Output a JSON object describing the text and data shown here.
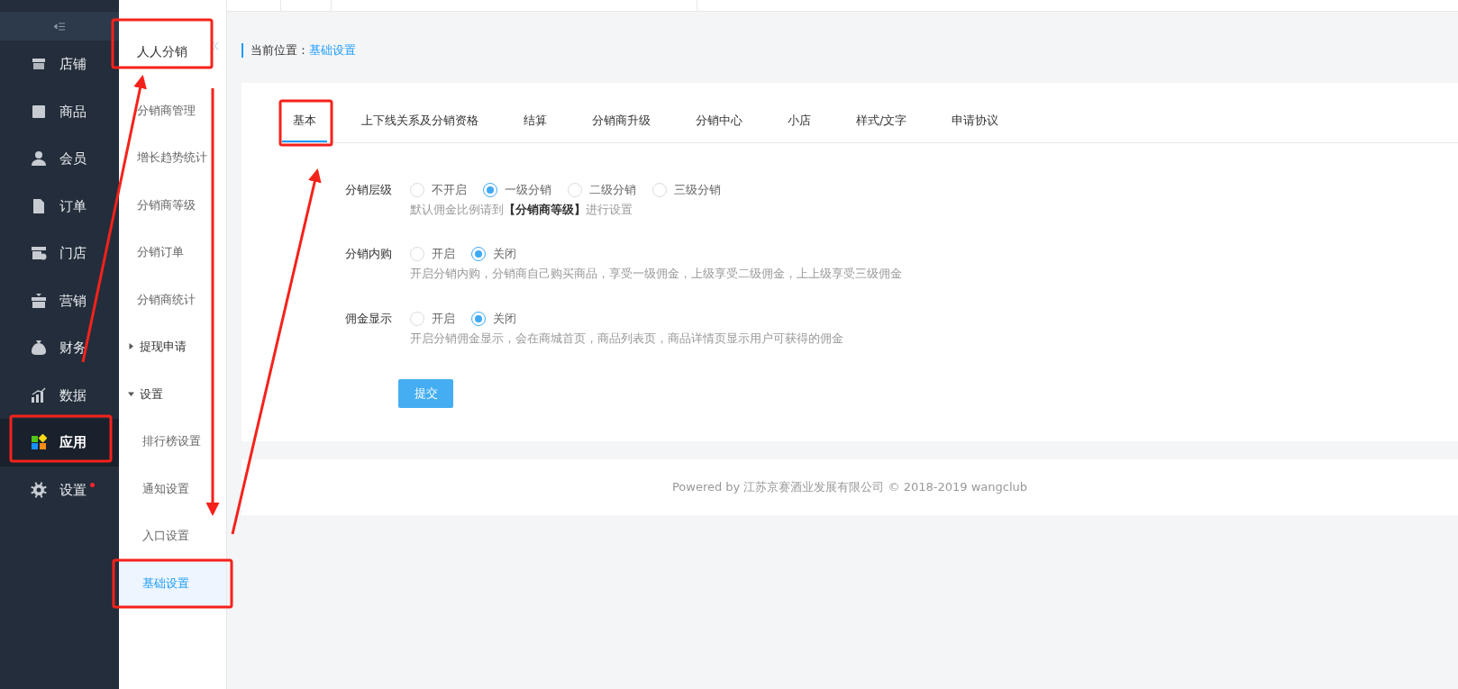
{
  "sidebar": {
    "items": [
      {
        "label": "店铺",
        "selected": false,
        "dot": false
      },
      {
        "label": "商品",
        "selected": false,
        "dot": false
      },
      {
        "label": "会员",
        "selected": false,
        "dot": false
      },
      {
        "label": "订单",
        "selected": false,
        "dot": false
      },
      {
        "label": "门店",
        "selected": false,
        "dot": false
      },
      {
        "label": "营销",
        "selected": false,
        "dot": false
      },
      {
        "label": "财务",
        "selected": false,
        "dot": false
      },
      {
        "label": "数据",
        "selected": false,
        "dot": false
      },
      {
        "label": "应用",
        "selected": true,
        "dot": false
      },
      {
        "label": "设置",
        "selected": false,
        "dot": true
      }
    ]
  },
  "subnav": {
    "title": "人人分销",
    "items": [
      {
        "label": "分销商管理",
        "selected": false
      },
      {
        "label": "增长趋势统计",
        "selected": false
      },
      {
        "label": "分销商等级",
        "selected": false
      },
      {
        "label": "分销订单",
        "selected": false
      },
      {
        "label": "分销商统计",
        "selected": false
      },
      {
        "label": "提现申请",
        "expanded": false
      },
      {
        "label": "设置",
        "expanded": true,
        "children": [
          {
            "label": "排行榜设置",
            "selected": false
          },
          {
            "label": "通知设置",
            "selected": false
          },
          {
            "label": "入口设置",
            "selected": false
          },
          {
            "label": "基础设置",
            "selected": true
          }
        ]
      }
    ]
  },
  "breadcrumb": {
    "prefix": "当前位置：",
    "current": "基础设置"
  },
  "tabs": [
    {
      "label": "基本",
      "selected": true
    },
    {
      "label": "上下线关系及分销资格",
      "selected": false
    },
    {
      "label": "结算",
      "selected": false
    },
    {
      "label": "分销商升级",
      "selected": false
    },
    {
      "label": "分销中心",
      "selected": false
    },
    {
      "label": "小店",
      "selected": false
    },
    {
      "label": "样式/文字",
      "selected": false
    },
    {
      "label": "申请协议",
      "selected": false
    }
  ],
  "form": {
    "fields": [
      {
        "label": "分销层级",
        "options": [
          {
            "label": "不开启",
            "selected": false
          },
          {
            "label": "一级分销",
            "selected": true
          },
          {
            "label": "二级分销",
            "selected": false
          },
          {
            "label": "三级分销",
            "selected": false
          }
        ],
        "hint": "默认佣金比例请到**【分销商等级】**进行设置"
      },
      {
        "label": "分销内购",
        "options": [
          {
            "label": "开启",
            "selected": false
          },
          {
            "label": "关闭",
            "selected": true
          }
        ],
        "hint": "开启分销内购，分销商自己购买商品，享受一级佣金，上级享受二级佣金，上上级享受三级佣金"
      },
      {
        "label": "佣金显示",
        "options": [
          {
            "label": "开启",
            "selected": false
          },
          {
            "label": "关闭",
            "selected": true
          }
        ],
        "hint": "开启分销佣金显示，会在商城首页，商品列表页，商品详情页显示用户可获得的佣金"
      }
    ],
    "submit": "提交"
  },
  "footer": "Powered by 江苏京赛酒业发展有限公司 © 2018-2019 wangclub"
}
